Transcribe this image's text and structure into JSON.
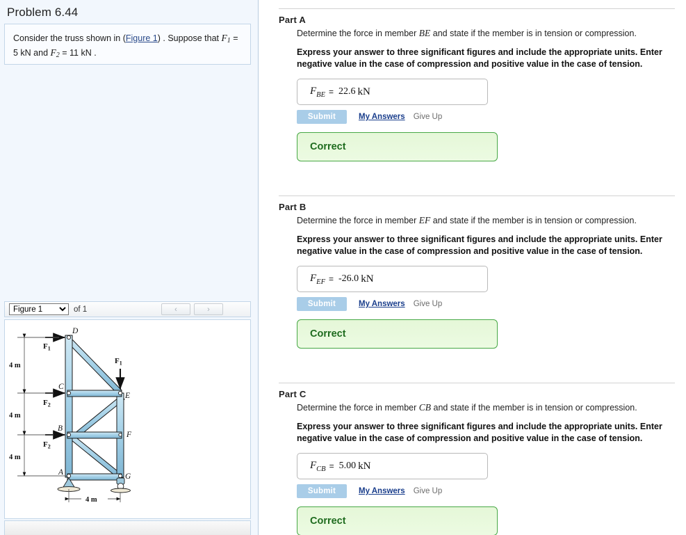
{
  "left": {
    "problem_title": "Problem 6.44",
    "question": {
      "prefix": "Consider the truss shown in (",
      "figure_link": "Figure 1",
      "middle": ") . Suppose that ",
      "F1_sym": "F",
      "F1_sub": "1",
      "mid2": " = 5  kN and ",
      "F2_sym": "F",
      "F2_sub": "2",
      "suffix": " = 11  kN ."
    },
    "figure_toolbar": {
      "selected": "Figure 1",
      "options": [
        "Figure 1"
      ],
      "of_label": "of 1",
      "prev_icon": "chevron-left-icon",
      "next_icon": "chevron-right-icon",
      "prev_glyph": "‹",
      "next_glyph": "›"
    },
    "figure": {
      "caption_nodes": [
        "A",
        "B",
        "C",
        "D",
        "E",
        "F",
        "G"
      ],
      "dimensions_vertical": [
        "4 m",
        "4 m",
        "4 m"
      ],
      "dimension_horizontal": "4 m",
      "load_labels": [
        {
          "name": "F",
          "sub": "1",
          "at": "D",
          "direction": "right"
        },
        {
          "name": "F",
          "sub": "1",
          "at": "E",
          "direction": "down"
        },
        {
          "name": "F",
          "sub": "2",
          "at": "C",
          "direction": "right"
        },
        {
          "name": "F",
          "sub": "2",
          "at": "B",
          "direction": "right"
        }
      ],
      "member_color": "#a9d4e8",
      "member_stroke": "#1b1b1b"
    }
  },
  "parts": [
    {
      "id": "partA",
      "title": "Part A",
      "prompt_before": "Determine the force in member ",
      "member": "BE",
      "prompt_after": " and state if the member is in tension or compression.",
      "instructions": "Express your answer to three significant figures and include the appropriate units. Enter negative value in the case of compression and positive value in the case of tension.",
      "answer": {
        "symbol": "F",
        "subscript": "BE",
        "equals": "=",
        "value": "22.6",
        "unit": "kN"
      },
      "submit_label": "Submit",
      "my_answers_label": "My Answers",
      "give_up_label": "Give Up",
      "feedback": "Correct"
    },
    {
      "id": "partB",
      "title": "Part B",
      "prompt_before": "Determine the force in member ",
      "member": "EF",
      "prompt_after": " and state if the member is in tension or compression.",
      "instructions": "Express your answer to three significant figures and include the appropriate units. Enter negative value in the case of compression and positive value in the case of tension.",
      "answer": {
        "symbol": "F",
        "subscript": "EF",
        "equals": "=",
        "value": "-26.0",
        "unit": "kN"
      },
      "submit_label": "Submit",
      "my_answers_label": "My Answers",
      "give_up_label": "Give Up",
      "feedback": "Correct"
    },
    {
      "id": "partC",
      "title": "Part C",
      "prompt_before": "Determine the force in member ",
      "member": "CB",
      "prompt_after": " and state if the member is in tension or compression.",
      "instructions": "Express your answer to three significant figures and include the appropriate units. Enter negative value in the case of compression and positive value in the case of tension.",
      "answer": {
        "symbol": "F",
        "subscript": "CB",
        "equals": "=",
        "value": "5.00",
        "unit": "kN"
      },
      "submit_label": "Submit",
      "my_answers_label": "My Answers",
      "give_up_label": "Give Up",
      "feedback": "Correct"
    }
  ],
  "colors": {
    "panel_bg": "#f2f7fd",
    "submit_bg": "#a9cde8",
    "correct_border": "#47a845",
    "correct_text": "#1e6b1e",
    "link": "#1a3e8c"
  }
}
